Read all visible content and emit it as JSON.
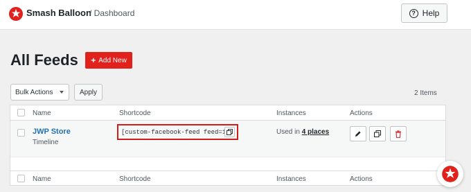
{
  "header": {
    "brand": "Smash Balloon",
    "breadcrumb": "/ Dashboard",
    "help_label": "Help"
  },
  "page": {
    "title": "All Feeds",
    "add_new_label": "Add New"
  },
  "toolbar": {
    "bulk_actions_label": "Bulk Actions",
    "apply_label": "Apply",
    "items_count": "2 Items"
  },
  "table": {
    "columns": [
      "Name",
      "Shortcode",
      "Instances",
      "Actions"
    ],
    "rows": [
      {
        "name": "JWP Store",
        "type": "Timeline",
        "shortcode": "[custom-facebook-feed feed=1]",
        "instances_prefix": "Used in",
        "instances_link": "4 places"
      }
    ]
  },
  "colors": {
    "accent_red": "#e0211c",
    "link_blue": "#2271b1",
    "highlight_border": "#d11c1c"
  },
  "icons": [
    "smash-balloon-logo-icon",
    "question-circle-icon",
    "plus-icon",
    "chevron-down-icon",
    "copy-icon",
    "pencil-icon",
    "duplicate-icon",
    "trash-icon"
  ]
}
